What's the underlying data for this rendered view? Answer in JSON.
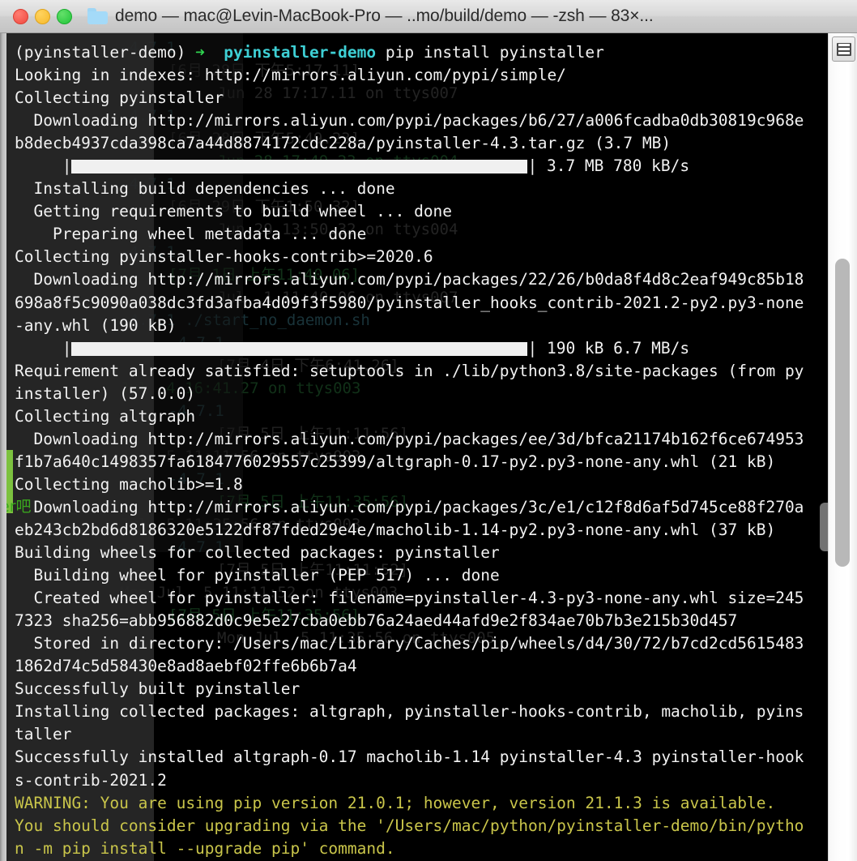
{
  "window": {
    "title": "demo — mac@Levin-MacBook-Pro — ..mo/build/demo — -zsh — 83×...",
    "folder_icon": "folder-icon",
    "traffic_lights": [
      {
        "name": "close-button",
        "color": "#f0493f"
      },
      {
        "name": "minimize-button",
        "color": "#f6b92b"
      },
      {
        "name": "zoom-button",
        "color": "#21c53a"
      }
    ]
  },
  "colors": {
    "terminal_bg": "#000000",
    "foreground": "#f2f2f2",
    "prompt_arrow": "#2fd34f",
    "prompt_dir": "#3ecfd4",
    "warning": "#c9c54a",
    "titlebar_bg": "#d0d0d0",
    "scrollbar_thumb": "#b8b8b8"
  },
  "scrollbar": {
    "name": "vertical-scrollbar",
    "thumb_name": "scrollbar-thumb",
    "button_icon": "rows-icon"
  },
  "terminal": {
    "prompt": {
      "env": "(pyinstaller-demo)",
      "arrow": "➜",
      "dir": "pyinstaller-demo",
      "command": "pip install pyinstaller"
    },
    "lines": [
      {
        "type": "prompt"
      },
      {
        "type": "text",
        "text": "Looking in indexes: http://mirrors.aliyun.com/pypi/simple/"
      },
      {
        "type": "text",
        "text": "Collecting pyinstaller"
      },
      {
        "type": "text",
        "text": "  Downloading http://mirrors.aliyun.com/pypi/packages/b6/27/a006fcadba0db30819c968e"
      },
      {
        "type": "text",
        "text": "b8decb4937cda398ca7a44d8874172cdc228a/pyinstaller-4.3.tar.gz (3.7 MB)"
      },
      {
        "type": "progress",
        "indent": 5,
        "blocks": 48,
        "text": " 3.7 MB 780 kB/s"
      },
      {
        "type": "text",
        "text": "  Installing build dependencies ... done"
      },
      {
        "type": "text",
        "text": "  Getting requirements to build wheel ... done"
      },
      {
        "type": "text",
        "text": "    Preparing wheel metadata ... done"
      },
      {
        "type": "text",
        "text": "Collecting pyinstaller-hooks-contrib>=2020.6"
      },
      {
        "type": "text",
        "text": "  Downloading http://mirrors.aliyun.com/pypi/packages/22/26/b0da8f4d8c2eaf949c85b18"
      },
      {
        "type": "text",
        "text": "698a8f5c9090a038dc3fd3afba4d09f3f5980/pyinstaller_hooks_contrib-2021.2-py2.py3-none"
      },
      {
        "type": "text",
        "text": "-any.whl (190 kB)"
      },
      {
        "type": "progress",
        "indent": 5,
        "blocks": 48,
        "text": " 190 kB 6.7 MB/s"
      },
      {
        "type": "text",
        "text": "Requirement already satisfied: setuptools in ./lib/python3.8/site-packages (from py"
      },
      {
        "type": "text",
        "text": "installer) (57.0.0)"
      },
      {
        "type": "text",
        "text": "Collecting altgraph"
      },
      {
        "type": "text",
        "text": "  Downloading http://mirrors.aliyun.com/pypi/packages/ee/3d/bfca21174b162f6ce674953"
      },
      {
        "type": "text",
        "text": "f1b7a640c1498357fa6184776029557c25399/altgraph-0.17-py2.py3-none-any.whl (21 kB)"
      },
      {
        "type": "text",
        "text": "Collecting macholib>=1.8"
      },
      {
        "type": "text",
        "text": "  Downloading http://mirrors.aliyun.com/pypi/packages/3c/e1/c12f8d6af5d745ce88f270a"
      },
      {
        "type": "text",
        "text": "eb243cb2bd6d8186320e5122df87fded29e4e/macholib-1.14-py2.py3-none-any.whl (37 kB)"
      },
      {
        "type": "text",
        "text": "Building wheels for collected packages: pyinstaller"
      },
      {
        "type": "text",
        "text": "  Building wheel for pyinstaller (PEP 517) ... done"
      },
      {
        "type": "text",
        "text": "  Created wheel for pyinstaller: filename=pyinstaller-4.3-py3-none-any.whl size=245"
      },
      {
        "type": "text",
        "text": "7323 sha256=abb956882d0c9e5e27cba0ebb76a24aed44afd9e2f834ae70b7b3e215b30d457"
      },
      {
        "type": "text",
        "text": "  Stored in directory: /Users/mac/Library/Caches/pip/wheels/d4/30/72/b7cd2cd5615483"
      },
      {
        "type": "text",
        "text": "1862d74c5d58430e8ad8aebf02ffe6b6b7a4"
      },
      {
        "type": "text",
        "text": "Successfully built pyinstaller"
      },
      {
        "type": "text",
        "text": "Installing collected packages: altgraph, pyinstaller-hooks-contrib, macholib, pyins"
      },
      {
        "type": "text",
        "text": "taller"
      },
      {
        "type": "text",
        "text": "Successfully installed altgraph-0.17 macholib-1.14 pyinstaller-4.3 pyinstaller-hook"
      },
      {
        "type": "text",
        "text": "s-contrib-2021.2"
      },
      {
        "type": "warn",
        "text": "WARNING: You are using pip version 21.0.1; however, version 21.1.3 is available."
      },
      {
        "type": "warn",
        "text": "You should consider upgrading via the '/Users/mac/python/pyinstaller-demo/bin/pytho"
      },
      {
        "type": "warn",
        "text": "n -m pip install --upgrade pip' command."
      }
    ]
  },
  "background_ghost": {
    "badge_text": "er吧",
    "lines": [
      "-4.7.1",
      "[6月 28日 下午5:17.11]",
      "Jun 28 17:17.11 on ttys007",
      "-4.7.1",
      "[6月 28日 下午5:49.23]",
      "Jun 28 17:49.23 on ttys004",
      "-4.7.1",
      "[6月 29日 下午1:50.32]",
      "Jun 29 13:50.32 on ttys004",
      "-4.7.1",
      "[7月 1日 上午11:40.06]",
      "Jul  1 11:40.06 on ttys007",
      "-4.7.1 ./start_no_daemon.sh",
      "-4.7.1",
      "[7月 4日 下午6:41.26]",
      "Jul  4 16:41.27 on ttys003",
      "-4.7.1",
      "[7月 5日 上午11:11:56]",
      "Jul  5 11:11:56 on ttys003",
      "-4.7.1",
      "[7月 5日 上午11:35:56]",
      "Jul  5 11:35:56 on ttys003",
      "-4.7.1",
      "[7月 5日 上午11:11:52]",
      "Mon Jul  5 11:11:52 on ttys003",
      "[7月 5日 上午11:35:56]",
      "Mon Jul  5 11:35:56 on ttys005"
    ]
  }
}
